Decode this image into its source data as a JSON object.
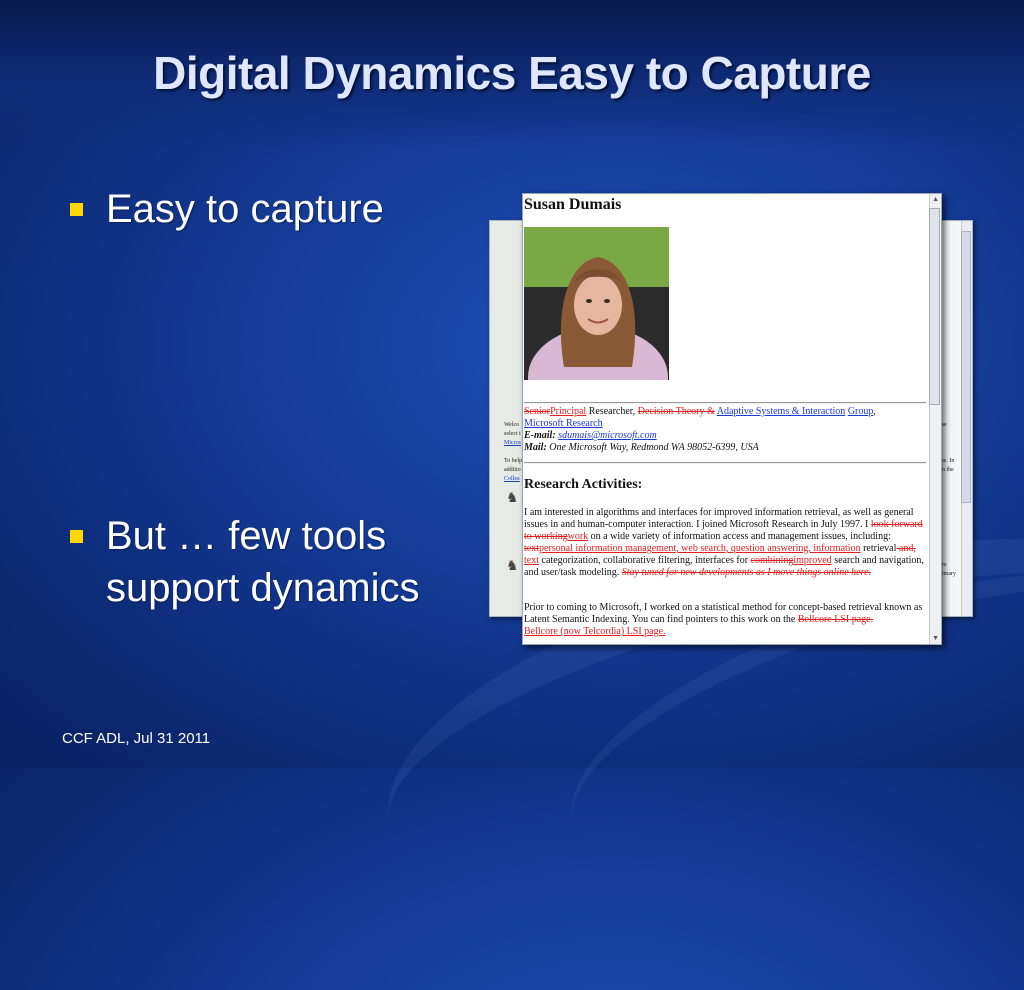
{
  "slide": {
    "title": "Digital Dynamics Easy to Capture",
    "bullets": [
      "Easy to capture",
      "But … few tools support dynamics"
    ],
    "footer": "CCF ADL, Jul 31 2011",
    "colors": {
      "background": "#163f9c",
      "bullet": "#ffd800",
      "title": "#dfe7ff"
    }
  },
  "screenshot_front": {
    "name": "Susan Dumais",
    "role_struck": "Senior",
    "role_added": "Principal",
    "role_rest": " Researcher, ",
    "group_struck": "Decision Theory &",
    "group_link": "Adaptive Systems & Interaction",
    "group_link2": "Group",
    "org_link": "Microsoft Research",
    "email_label": "E-mail:",
    "email": "sdumais@microsoft.com",
    "mail_label": "Mail:",
    "mail": "One Microsoft Way, Redmond WA 98052-6399, USA",
    "section_heading": "Research Activities:",
    "p1_a": "I am interested in algorithms and interfaces for improved information retrieval, as well as general issues in and human-computer interaction. I joined Microsoft Research in July 1997. I ",
    "p1_struck1": "look forward to working",
    "p1_added1": "work",
    "p1_b": " on a wide variety of information access and management issues, including: ",
    "p1_struck2": "text",
    "p1_added2": "personal information management, web search, question answering, information",
    "p1_c": " retrieval",
    "p1_struck3": " and,",
    "p1_added3": " text",
    "p1_d": " categorization, collaborative filtering, interfaces for ",
    "p1_struck4": "combining",
    "p1_added4": "improved",
    "p1_e": " search and navigation, and user/task modeling. ",
    "p1_struck5": "Stay tuned for new developments as I move things online here.",
    "p2_a": "Prior to coming to Microsoft, I worked on a statistical method for concept-based retrieval known as Latent Semantic Indexing. You can find pointers to this work on the ",
    "p2_struck": "Bellcore LSI page.",
    "p2_added": "Bellcore (now Telcordia)  LSI page."
  },
  "screenshot_back": {
    "left_frags": [
      "Welco",
      "select t",
      "Micros",
      "To help",
      "additio",
      "Collea"
    ],
    "right_frags": [
      "ase",
      "me. In",
      "on the",
      "ore",
      "bimary"
    ]
  }
}
